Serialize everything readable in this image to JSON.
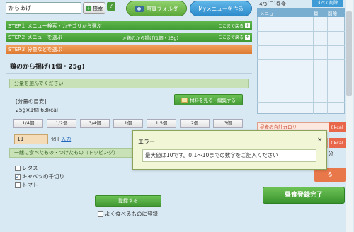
{
  "search": {
    "value": "からあげ",
    "button_label": "検索",
    "help_label": "?"
  },
  "top_buttons": {
    "photo_folder": "写真フォルダ",
    "my_menu": "Myメニューを作る"
  },
  "steps": [
    {
      "label": "STEP１ メニュー検索・カテゴリから選ぶ",
      "right": "ここまで戻る"
    },
    {
      "label": "STEP２ メニューを選ぶ",
      "middle": ">鶏のから揚げ(1個・25g)",
      "right": "ここまで戻る"
    },
    {
      "label": "STEP３ 分量などを選ぶ"
    }
  ],
  "food": {
    "title": "鶏のから揚げ(1個・25g)"
  },
  "amount_section": {
    "heading": "分量を選んでください",
    "guide_label": "[分量の目安]",
    "guide_value": "25g×1個 63kcal",
    "material_button": "材料を見る・編集する",
    "portions": [
      "1/4個",
      "1/2個",
      "3/4個",
      "1個",
      "1.5個",
      "2個",
      "3個"
    ],
    "input_value": "11",
    "unit": "個",
    "enter_open": "[",
    "enter_link": "入力",
    "enter_close": "]"
  },
  "topping": {
    "heading": "一緒に食べたもの・つけたもの（トッピング）",
    "items": [
      {
        "label": "レタス",
        "checked": ""
      },
      {
        "label": "キャベツの千切り",
        "checked": "✓"
      },
      {
        "label": "トマト",
        "checked": ""
      }
    ]
  },
  "register_button": "登録する",
  "favorite_label": "よく食べるものに登録",
  "right_panel": {
    "date": "4/3(日)昼食",
    "clear_all": "すべて削除",
    "columns": [
      "メニュー",
      "量",
      "削除"
    ],
    "calorie_label": "昼食の合計カロリー",
    "calorie_value": "0kcal",
    "calorie_value2": "0kcal",
    "side_fragment": "分",
    "orange_fragment": "る",
    "complete_button": "昼食登録完了"
  },
  "modal": {
    "title": "エラー",
    "close": "×",
    "message": "最大値は10です。0.1～10までの数字をご記入ください"
  },
  "colors": {
    "green": "#439a35",
    "orange": "#de7c33",
    "blue": "#2f8ccc",
    "error_red": "#e8664a"
  }
}
